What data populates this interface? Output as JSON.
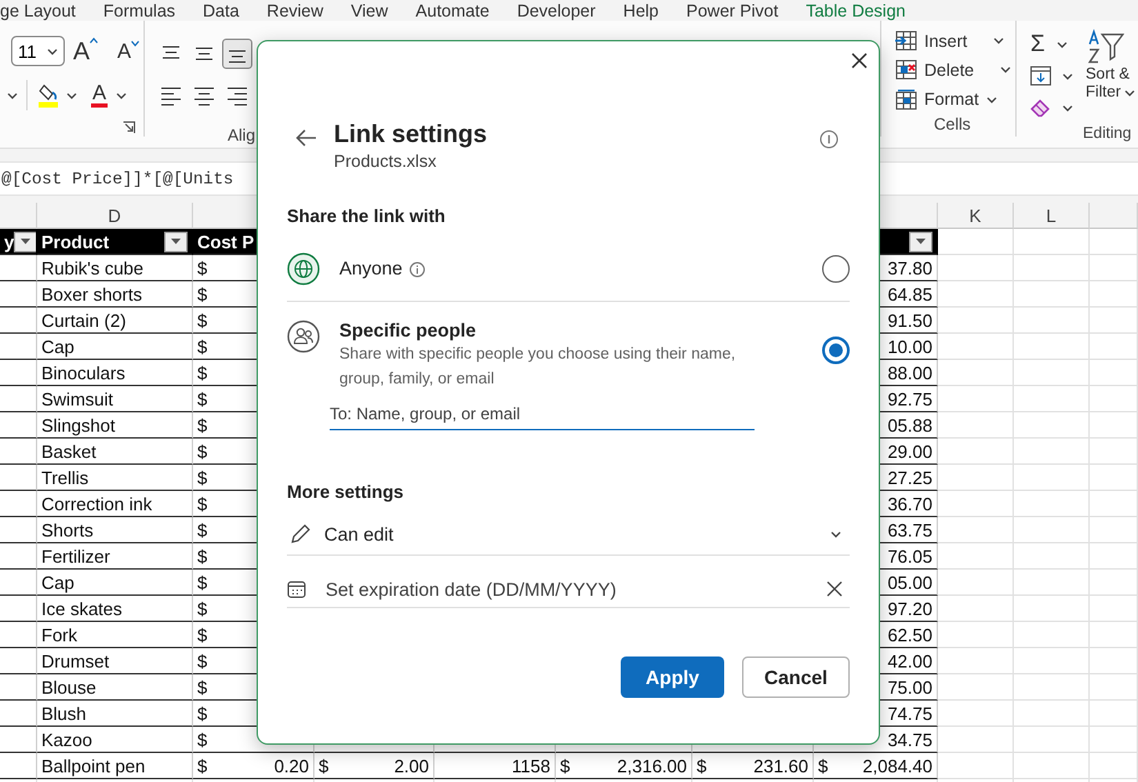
{
  "ribbon_tabs": [
    {
      "label": "ge Layout",
      "contextual": false
    },
    {
      "label": "Formulas",
      "contextual": false
    },
    {
      "label": "Data",
      "contextual": false
    },
    {
      "label": "Review",
      "contextual": false
    },
    {
      "label": "View",
      "contextual": false
    },
    {
      "label": "Automate",
      "contextual": false
    },
    {
      "label": "Developer",
      "contextual": false
    },
    {
      "label": "Help",
      "contextual": false
    },
    {
      "label": "Power Pivot",
      "contextual": false
    },
    {
      "label": "Table Design",
      "contextual": true
    }
  ],
  "ribbon": {
    "font_group": {
      "font_size": "11",
      "grow_font_label": "A",
      "shrink_font_label": "A",
      "font_color_label": "A"
    },
    "alignment_group": {
      "label": "Alig",
      "buttons": [
        {
          "kind": "top",
          "selected": false
        },
        {
          "kind": "middle",
          "selected": false
        },
        {
          "kind": "bottom",
          "selected": true
        },
        {
          "kind": "left",
          "selected": false
        },
        {
          "kind": "center",
          "selected": false
        },
        {
          "kind": "right",
          "selected": false
        }
      ]
    },
    "cells_group": {
      "label": "Cells",
      "buttons": [
        {
          "kind": "insert",
          "label": "Insert"
        },
        {
          "kind": "delete",
          "label": "Delete"
        },
        {
          "kind": "format",
          "label": "Format"
        }
      ]
    },
    "editing_group": {
      "label": "Editing",
      "autosum_symbol": "Σ",
      "sort_filter_lines": [
        "Sort &",
        "Filter"
      ]
    }
  },
  "formula_bar": {
    "formula": "@[Cost Price]]*[@[Units"
  },
  "sheet": {
    "column_headers": [
      "D",
      "K",
      "L"
    ],
    "table_headers": [
      "y",
      "Product",
      "Cost P"
    ],
    "rows": [
      {
        "product": "Rubik's cube",
        "cost_currency": "$",
        "total": "37.80"
      },
      {
        "product": "Boxer shorts",
        "cost_currency": "$",
        "total": "64.85"
      },
      {
        "product": "Curtain (2)",
        "cost_currency": "$",
        "total": "91.50"
      },
      {
        "product": "Cap",
        "cost_currency": "$",
        "total": "10.00"
      },
      {
        "product": "Binoculars",
        "cost_currency": "$",
        "total": "88.00"
      },
      {
        "product": "Swimsuit",
        "cost_currency": "$",
        "total": "92.75"
      },
      {
        "product": "Slingshot",
        "cost_currency": "$",
        "total": "05.88"
      },
      {
        "product": "Basket",
        "cost_currency": "$",
        "total": "29.00"
      },
      {
        "product": "Trellis",
        "cost_currency": "$",
        "total": "27.25"
      },
      {
        "product": "Correction ink",
        "cost_currency": "$",
        "total": "36.70"
      },
      {
        "product": "Shorts",
        "cost_currency": "$",
        "total": "63.75"
      },
      {
        "product": "Fertilizer",
        "cost_currency": "$",
        "total": "76.05"
      },
      {
        "product": "Cap",
        "cost_currency": "$",
        "total": "05.00"
      },
      {
        "product": "Ice skates",
        "cost_currency": "$",
        "total": "97.20"
      },
      {
        "product": "Fork",
        "cost_currency": "$",
        "total": "62.50"
      },
      {
        "product": "Drumset",
        "cost_currency": "$",
        "total": "42.00"
      },
      {
        "product": "Blouse",
        "cost_currency": "$",
        "total": "75.00"
      },
      {
        "product": "Blush",
        "cost_currency": "$",
        "total": "74.75"
      },
      {
        "product": "Kazoo",
        "cost_currency": "$",
        "total": "34.75"
      },
      {
        "product": "Ballpoint pen",
        "cost_currency": "$",
        "cost_price": "0.20",
        "unit_price_currency": "$",
        "unit_price": "2.00",
        "units_sold": "1158",
        "revenue_currency": "$",
        "revenue": "2,316.00",
        "discount_currency": "$",
        "discount": "231.60",
        "total_currency": "$",
        "total": "2,084.40"
      }
    ]
  },
  "dialog": {
    "title": "Link settings",
    "file_name": "Products.xlsx",
    "section_title": "Share the link with",
    "share_options": [
      {
        "kind": "anyone",
        "label": "Anyone",
        "has_info": true,
        "selected": false
      },
      {
        "kind": "people",
        "label": "Specific people",
        "description": "Share with specific people you choose using their name, group, family, or email",
        "has_info": false,
        "selected": true,
        "recipient_field": {
          "placeholder": "To: Name, group, or email"
        }
      }
    ],
    "more_settings_title": "More settings",
    "permission": "Can edit",
    "expiration_field": {
      "placeholder": "Set expiration date (DD/MM/YYYY)"
    },
    "buttons": [
      {
        "kind": "primary",
        "label": "Apply"
      },
      {
        "kind": "secondary",
        "label": "Cancel"
      }
    ]
  }
}
